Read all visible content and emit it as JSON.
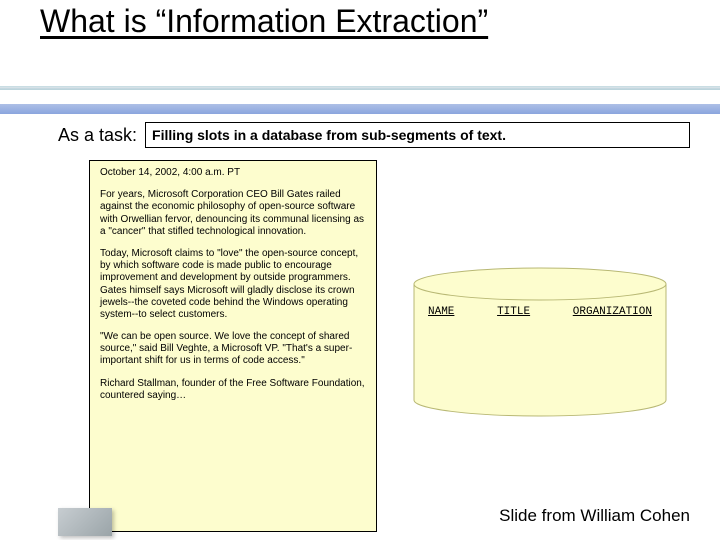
{
  "title": "What is “Information Extraction”",
  "subtitle_label": "As a task:",
  "definition": "Filling slots in a database from sub-segments of text.",
  "article": {
    "dateline": "October 14, 2002, 4:00 a.m. PT",
    "paragraphs": [
      "For years, Microsoft Corporation CEO Bill Gates railed against the economic philosophy of open-source software with Orwellian fervor, denouncing its communal licensing as a \"cancer\" that stifled technological innovation.",
      "Today, Microsoft claims to \"love\" the open-source concept, by which software code is made public to encourage improvement and development by outside programmers. Gates himself says Microsoft will gladly disclose its crown jewels--the coveted code behind the Windows operating system--to select customers.",
      "\"We can be open source. We love the concept of shared source,\" said Bill Veghte, a Microsoft VP. \"That's a super-important shift for us in terms of code access.\"",
      "Richard Stallman, founder of the Free Software Foundation, countered saying…"
    ]
  },
  "database": {
    "columns": [
      "NAME",
      "TITLE",
      "ORGANIZATION"
    ]
  },
  "credit": "Slide from William Cohen"
}
